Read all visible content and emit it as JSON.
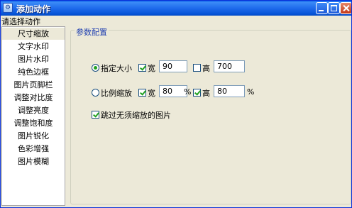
{
  "window": {
    "title": "添加动作"
  },
  "left_panel": {
    "label": "请选择动作",
    "items": [
      "尺寸缩放",
      "文字水印",
      "图片水印",
      "纯色边框",
      "图片页脚栏",
      "调整对比度",
      "调整亮度",
      "调整饱和度",
      "图片锐化",
      "色彩增强",
      "图片模糊"
    ],
    "selected": "尺寸缩放"
  },
  "config": {
    "group_title": "参数配置",
    "fixed_size": {
      "label": "指定大小",
      "checked": true,
      "width": {
        "label": "宽",
        "checked": true,
        "value": "90"
      },
      "height": {
        "label": "高",
        "checked": false,
        "value": "700"
      }
    },
    "ratio": {
      "label": "比例缩放",
      "checked": false,
      "width": {
        "label": "宽",
        "checked": true,
        "value": "80",
        "unit": "%"
      },
      "height": {
        "label": "高",
        "checked": true,
        "value": "80",
        "unit": "%"
      }
    },
    "skip": {
      "label": "跳过无须缩放的图片",
      "checked": true
    }
  }
}
